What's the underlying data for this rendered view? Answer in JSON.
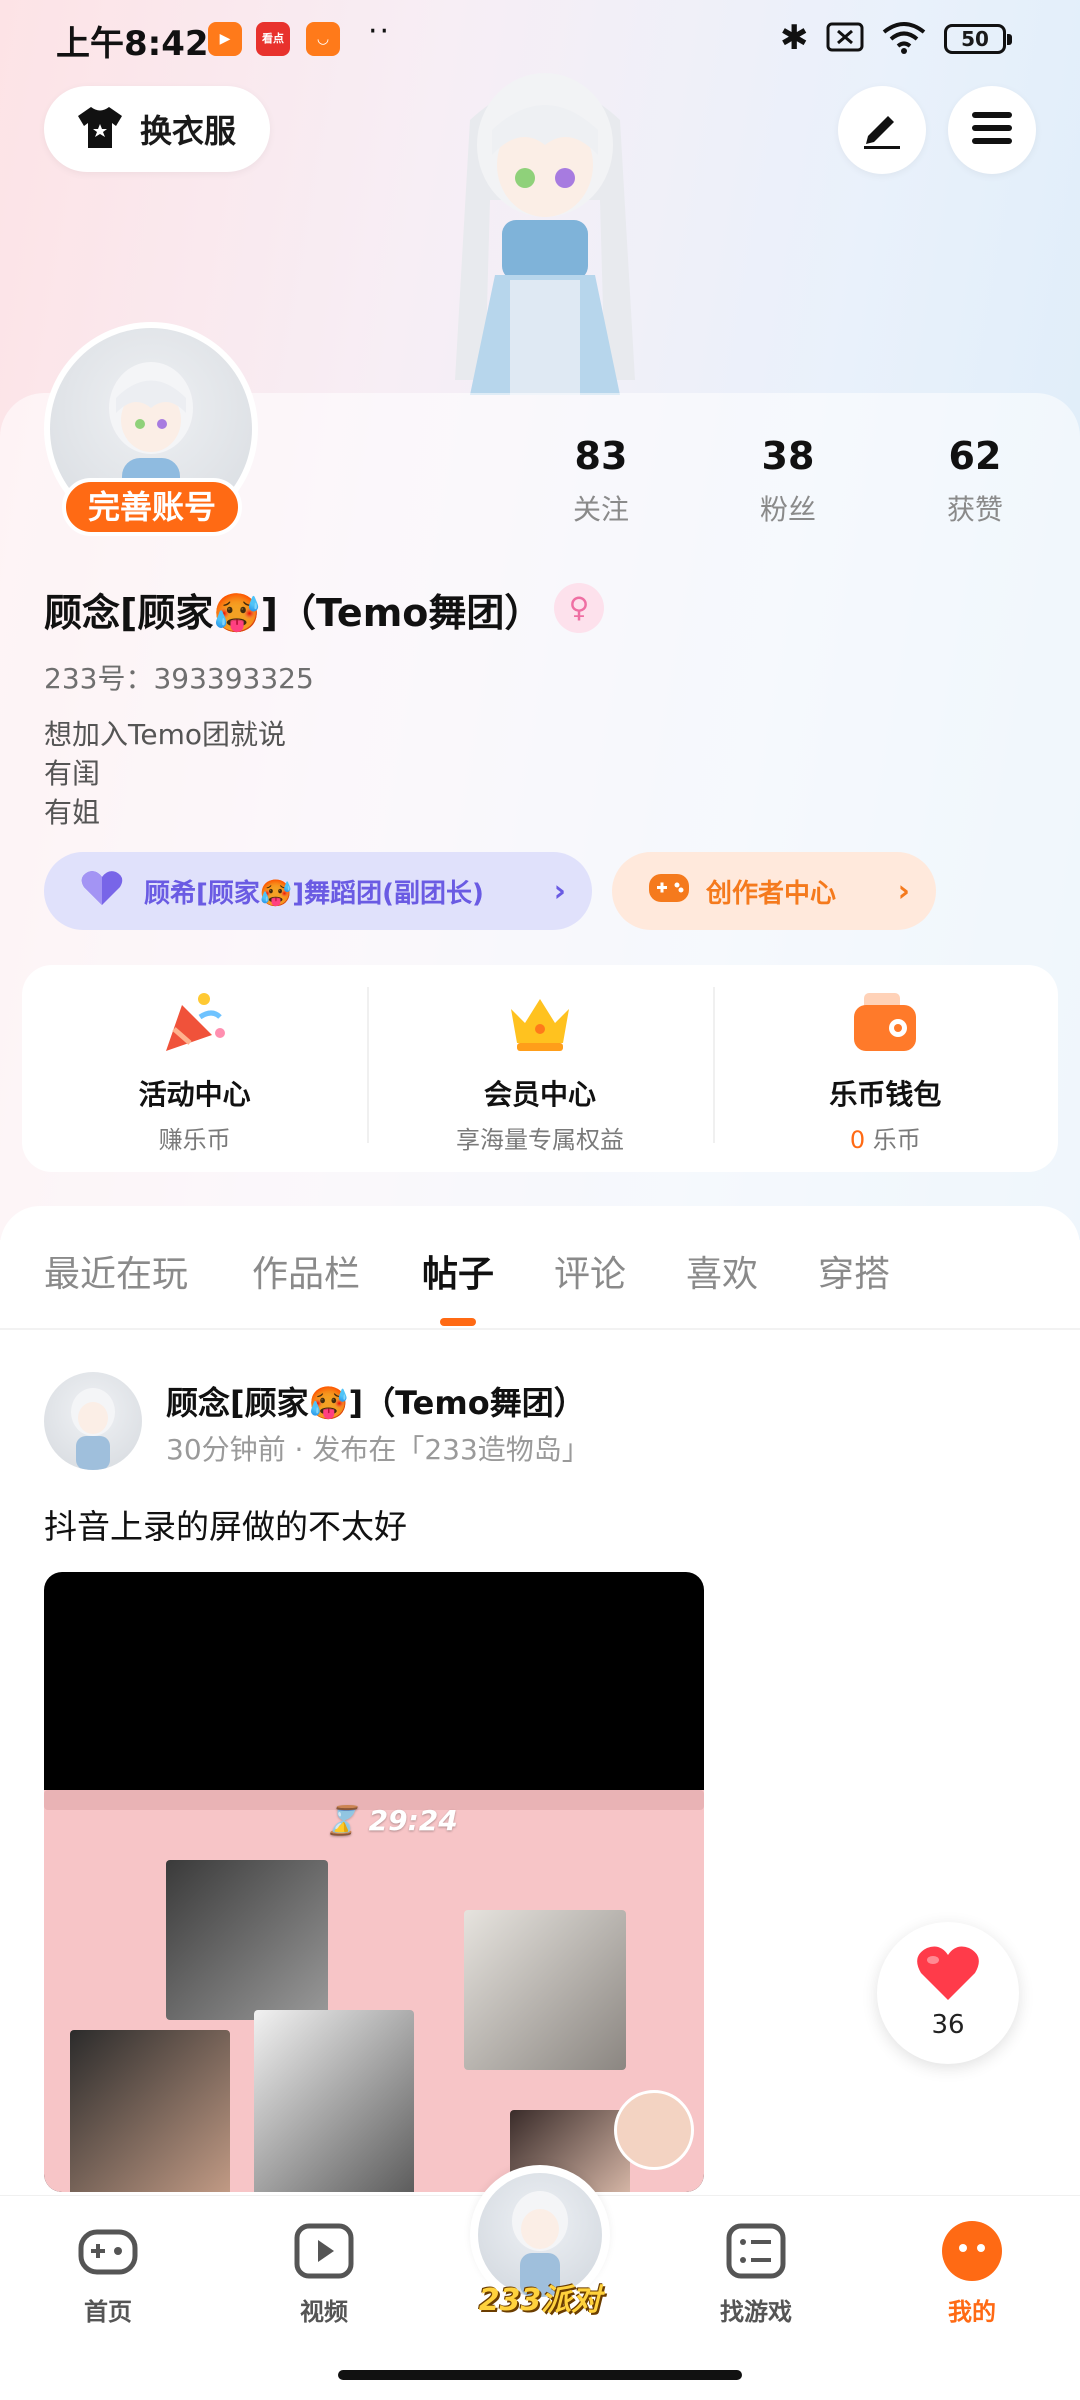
{
  "status_bar": {
    "time": "上午8:42",
    "battery": "50",
    "notif_app_label": "看点"
  },
  "header": {
    "outfit_label": "换衣服",
    "edit_icon": "pencil-icon",
    "menu_icon": "hamburger-icon"
  },
  "profile": {
    "complete_account": "完善账号",
    "stats": [
      {
        "num": "83",
        "label": "关注"
      },
      {
        "num": "38",
        "label": "粉丝"
      },
      {
        "num": "62",
        "label": "获赞"
      }
    ],
    "nickname": "顾念[顾家🥵]（Temo舞团）",
    "gender_symbol": "♀",
    "uid": "233号：393393325",
    "bio": [
      "想加入Temo团就说",
      "有闺",
      "有姐"
    ],
    "team_pill": "顾希[顾家🥵]舞蹈团(副团长)",
    "creator_pill": "创作者中心"
  },
  "features": [
    {
      "title": "活动中心",
      "sub": "赚乐币",
      "icon": "party-popper-icon"
    },
    {
      "title": "会员中心",
      "sub": "享海量专属权益",
      "icon": "crown-icon"
    },
    {
      "title": "乐币钱包",
      "sub_num": "0",
      "sub": "乐币",
      "icon": "wallet-icon"
    }
  ],
  "tabs": [
    "最近在玩",
    "作品栏",
    "帖子",
    "评论",
    "喜欢",
    "穿搭"
  ],
  "active_tab": "帖子",
  "post": {
    "author": "顾念[顾家🥵]（Temo舞团）",
    "meta": "30分钟前 · 发布在「233造物岛」",
    "text": "抖音上录的屏做的不太好",
    "video_timer": "29:24"
  },
  "like": {
    "count": "36"
  },
  "bottom_nav": [
    {
      "label": "首页",
      "icon": "gamepad-icon"
    },
    {
      "label": "视频",
      "icon": "play-icon"
    },
    {
      "label": "233派对",
      "icon": "avatar-icon"
    },
    {
      "label": "找游戏",
      "icon": "list-icon"
    },
    {
      "label": "我的",
      "icon": "face-icon"
    }
  ],
  "colors": {
    "accent": "#ff6a14",
    "team_purple": "#6a5be3",
    "creator_orange": "#f57a1d"
  }
}
